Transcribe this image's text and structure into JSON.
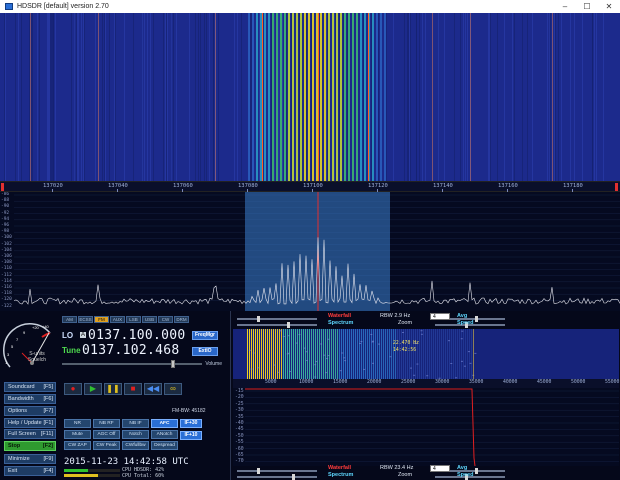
{
  "window": {
    "title": "HDSDR [default]  version 2.70",
    "buttons": [
      "–",
      "☐",
      "✕"
    ]
  },
  "ruler": {
    "ticks": [
      "137020",
      "137040",
      "137060",
      "137080",
      "137100",
      "137120",
      "137140",
      "137160",
      "137180"
    ]
  },
  "spectrum": {
    "db_labels": [
      "-86",
      "-88",
      "-90",
      "-92",
      "-94",
      "-96",
      "-98",
      "-100",
      "-102",
      "-104",
      "-106",
      "-108",
      "-110",
      "-112",
      "-114",
      "-116",
      "-118",
      "-120",
      "-122"
    ]
  },
  "smeter": {
    "label": "S-units\nSquelch",
    "scale": [
      "1",
      "3",
      "5",
      "7",
      "9",
      "+20",
      "+40"
    ]
  },
  "sidebar": {
    "items": [
      {
        "label": "Soundcard",
        "key": "[F5]"
      },
      {
        "label": "Bandwidth",
        "key": "[F6]"
      },
      {
        "label": "Options",
        "key": "[F7]"
      },
      {
        "label": "Help / Update",
        "key": "[F1]"
      },
      {
        "label": "Full Screen",
        "key": "[F11]"
      },
      {
        "label": "Stop",
        "key": "[F2]"
      },
      {
        "label": "Minimize",
        "key": "[F9]"
      },
      {
        "label": "Exit",
        "key": "[F4]"
      }
    ]
  },
  "modes": [
    "AM",
    "ECSS",
    "FM",
    "AUX",
    "LSB",
    "USB",
    "CW",
    "DRM"
  ],
  "modes_active": "FM",
  "lo": {
    "label": "LO",
    "tag": "A",
    "value": "0137.100.000"
  },
  "tune": {
    "label": "Tune",
    "value": "0137.102.468"
  },
  "freqmgr_label": "FreqMgr",
  "extio_label": "ExtIO",
  "volume_label": "Volume",
  "volume_level": 0.78,
  "transport": [
    {
      "name": "record",
      "glyph": "●",
      "color": "#e02020"
    },
    {
      "name": "play",
      "glyph": "▶",
      "color": "#30c030"
    },
    {
      "name": "pause",
      "glyph": "❚❚",
      "color": "#e0c020"
    },
    {
      "name": "stop",
      "glyph": "■",
      "color": "#e02020"
    },
    {
      "name": "rewind",
      "glyph": "◀◀",
      "color": "#4a8cf0"
    },
    {
      "name": "loop",
      "glyph": "∞",
      "color": "#e0c020"
    }
  ],
  "fm_bw": "FM-BW: 45182",
  "dsp": [
    {
      "label": "NR",
      "on": false
    },
    {
      "label": "NB RF",
      "on": false
    },
    {
      "label": "NB IF",
      "on": false
    },
    {
      "label": "AFC",
      "on": true
    },
    {
      "label": "Mute",
      "on": false
    },
    {
      "label": "AGC Off",
      "on": false
    },
    {
      "label": "Notch",
      "on": false
    },
    {
      "label": "ANotch",
      "on": false
    },
    {
      "label": "CW ZAP",
      "on": false
    },
    {
      "label": "CW Peak",
      "on": false
    },
    {
      "label": "CWfullbw",
      "on": false
    },
    {
      "label": "Despread",
      "on": false
    }
  ],
  "if_plus": "IF+30",
  "if_minus": "IF+10",
  "datetime": "2015-11-23  14:42:58 UTC",
  "cpu": {
    "hdsdr": "CPU HDSDR:  42%",
    "total": "CPU Total:  60%",
    "hdsdr_level": 0.42,
    "total_level": 0.6
  },
  "zoom_top": {
    "waterfall": "Waterfall",
    "spectrum": "Spectrum",
    "rbw": "RBW  2.9 Hz",
    "zoom": "Zoom",
    "select": "4",
    "avg": "Avg",
    "speed": "Speed"
  },
  "zoom_wf_note": {
    "line1": "22.470 Hz",
    "line2": "14:42:56"
  },
  "zoom_ruler": [
    "5000",
    "10000",
    "15000",
    "20000",
    "25000",
    "30000",
    "35000",
    "40000",
    "45000",
    "50000",
    "55000"
  ],
  "zoom_spec_db": [
    "-15",
    "-20",
    "-25",
    "-30",
    "-35",
    "-40",
    "-45",
    "-50",
    "-55",
    "-60",
    "-65",
    "-70"
  ],
  "zoom_bottom": {
    "waterfall": "Waterfall",
    "spectrum": "Spectrum",
    "rbw": "RBW  23.4 Hz",
    "zoom": "Zoom",
    "select": "4",
    "avg": "Avg",
    "speed": "Speed"
  },
  "colors": {
    "waterfall_bg": "#1a2a8a",
    "signal": "#f0e020",
    "passband": "#3a7fd0",
    "accent_green": "#30c030",
    "accent_blue": "#2a6fd6"
  }
}
